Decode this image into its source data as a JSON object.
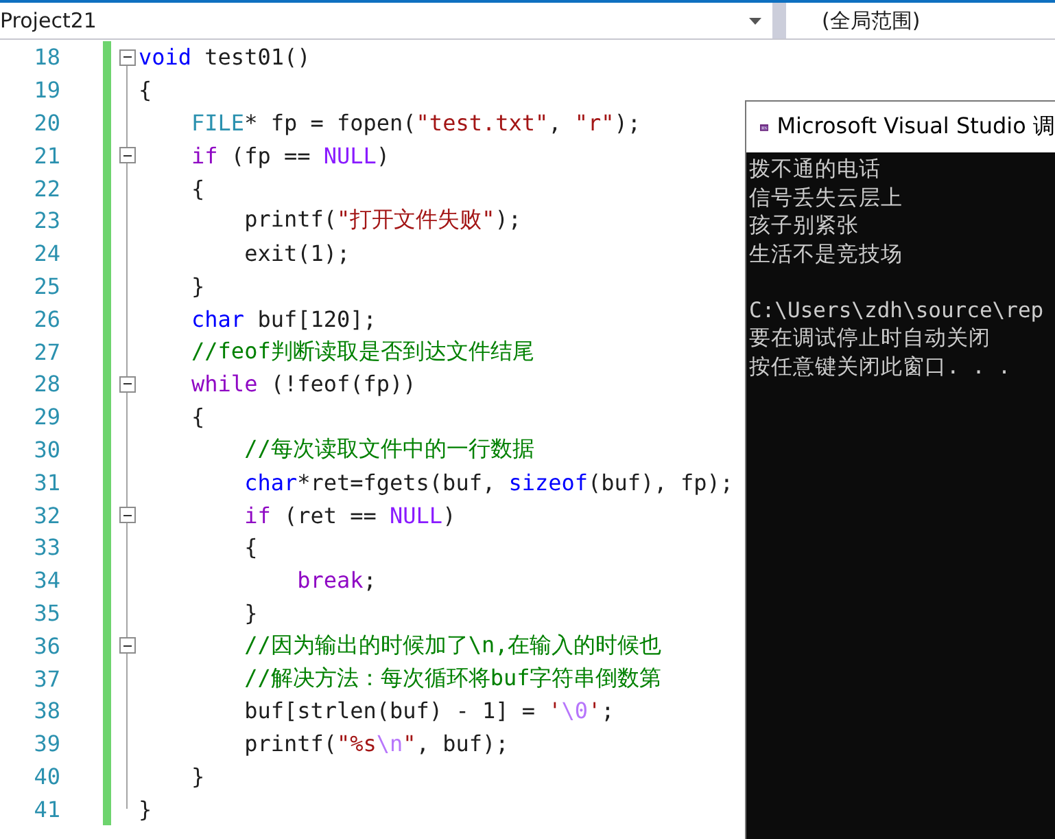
{
  "navigation_bar": {
    "project_dropdown": "Project21",
    "scope_dropdown": "(全局范围)"
  },
  "editor": {
    "lines": [
      {
        "number": "18",
        "fold": true,
        "tokens": [
          {
            "kind": "keyword",
            "text": "void"
          },
          {
            "kind": "plain",
            "text": " test01()"
          }
        ]
      },
      {
        "number": "19",
        "fold": false,
        "tokens": [
          {
            "kind": "plain",
            "text": "{"
          }
        ]
      },
      {
        "number": "20",
        "fold": false,
        "tokens": [
          {
            "kind": "type",
            "text": "    FILE"
          },
          {
            "kind": "plain",
            "text": "* fp = fopen("
          },
          {
            "kind": "string",
            "text": "\"test.txt\""
          },
          {
            "kind": "plain",
            "text": ", "
          },
          {
            "kind": "string",
            "text": "\"r\""
          },
          {
            "kind": "plain",
            "text": ");"
          }
        ]
      },
      {
        "number": "21",
        "fold": true,
        "tokens": [
          {
            "kind": "control",
            "text": "    if"
          },
          {
            "kind": "plain",
            "text": " (fp == "
          },
          {
            "kind": "macro",
            "text": "NULL"
          },
          {
            "kind": "plain",
            "text": ")"
          }
        ]
      },
      {
        "number": "22",
        "fold": false,
        "tokens": [
          {
            "kind": "plain",
            "text": "    {"
          }
        ]
      },
      {
        "number": "23",
        "fold": false,
        "tokens": [
          {
            "kind": "plain",
            "text": "        printf("
          },
          {
            "kind": "string",
            "text": "\"打开文件失败\""
          },
          {
            "kind": "plain",
            "text": ");"
          }
        ]
      },
      {
        "number": "24",
        "fold": false,
        "tokens": [
          {
            "kind": "plain",
            "text": "        exit(1);"
          }
        ]
      },
      {
        "number": "25",
        "fold": false,
        "tokens": [
          {
            "kind": "plain",
            "text": "    }"
          }
        ]
      },
      {
        "number": "26",
        "fold": false,
        "tokens": [
          {
            "kind": "keyword",
            "text": "    char"
          },
          {
            "kind": "plain",
            "text": " buf[120];"
          }
        ]
      },
      {
        "number": "27",
        "fold": false,
        "tokens": [
          {
            "kind": "comment",
            "text": "    //feof判断读取是否到达文件结尾"
          }
        ]
      },
      {
        "number": "28",
        "fold": true,
        "tokens": [
          {
            "kind": "control",
            "text": "    while"
          },
          {
            "kind": "plain",
            "text": " (!feof(fp))"
          }
        ]
      },
      {
        "number": "29",
        "fold": false,
        "tokens": [
          {
            "kind": "plain",
            "text": "    {"
          }
        ]
      },
      {
        "number": "30",
        "fold": false,
        "tokens": [
          {
            "kind": "comment",
            "text": "        //每次读取文件中的一行数据"
          }
        ]
      },
      {
        "number": "31",
        "fold": false,
        "tokens": [
          {
            "kind": "keyword",
            "text": "        char"
          },
          {
            "kind": "plain",
            "text": "*ret=fgets(buf, "
          },
          {
            "kind": "keyword",
            "text": "sizeof"
          },
          {
            "kind": "plain",
            "text": "(buf), fp);"
          }
        ]
      },
      {
        "number": "32",
        "fold": true,
        "tokens": [
          {
            "kind": "control",
            "text": "        if"
          },
          {
            "kind": "plain",
            "text": " (ret == "
          },
          {
            "kind": "macro",
            "text": "NULL"
          },
          {
            "kind": "plain",
            "text": ")"
          }
        ]
      },
      {
        "number": "33",
        "fold": false,
        "tokens": [
          {
            "kind": "plain",
            "text": "        {"
          }
        ]
      },
      {
        "number": "34",
        "fold": false,
        "tokens": [
          {
            "kind": "control",
            "text": "            break"
          },
          {
            "kind": "plain",
            "text": ";"
          }
        ]
      },
      {
        "number": "35",
        "fold": false,
        "tokens": [
          {
            "kind": "plain",
            "text": "        }"
          }
        ]
      },
      {
        "number": "36",
        "fold": true,
        "tokens": [
          {
            "kind": "comment",
            "text": "        //因为输出的时候加了\\n,在输入的时候也"
          }
        ]
      },
      {
        "number": "37",
        "fold": false,
        "tokens": [
          {
            "kind": "comment",
            "text": "        //解决方法：每次循环将buf字符串倒数第"
          }
        ]
      },
      {
        "number": "38",
        "fold": false,
        "tokens": [
          {
            "kind": "plain",
            "text": "        buf[strlen(buf) - 1] = "
          },
          {
            "kind": "string",
            "text": "'"
          },
          {
            "kind": "escape",
            "text": "\\0"
          },
          {
            "kind": "string",
            "text": "'"
          },
          {
            "kind": "plain",
            "text": ";"
          }
        ]
      },
      {
        "number": "39",
        "fold": false,
        "tokens": [
          {
            "kind": "plain",
            "text": "        printf("
          },
          {
            "kind": "string",
            "text": "\"%s"
          },
          {
            "kind": "escape",
            "text": "\\n"
          },
          {
            "kind": "string",
            "text": "\""
          },
          {
            "kind": "plain",
            "text": ", buf);"
          }
        ]
      },
      {
        "number": "40",
        "fold": false,
        "tokens": [
          {
            "kind": "plain",
            "text": "    }"
          }
        ]
      },
      {
        "number": "41",
        "fold": false,
        "tokens": [
          {
            "kind": "plain",
            "text": "}"
          }
        ]
      }
    ]
  },
  "console": {
    "title": "Microsoft Visual Studio 调",
    "output": [
      "拨不通的电话",
      "信号丢失云层上",
      "孩子别紧张",
      "生活不是竞技场"
    ],
    "messages": [
      "C:\\Users\\zdh\\source\\rep",
      "要在调试停止时自动关闭",
      "按任意键关闭此窗口. . ."
    ]
  }
}
